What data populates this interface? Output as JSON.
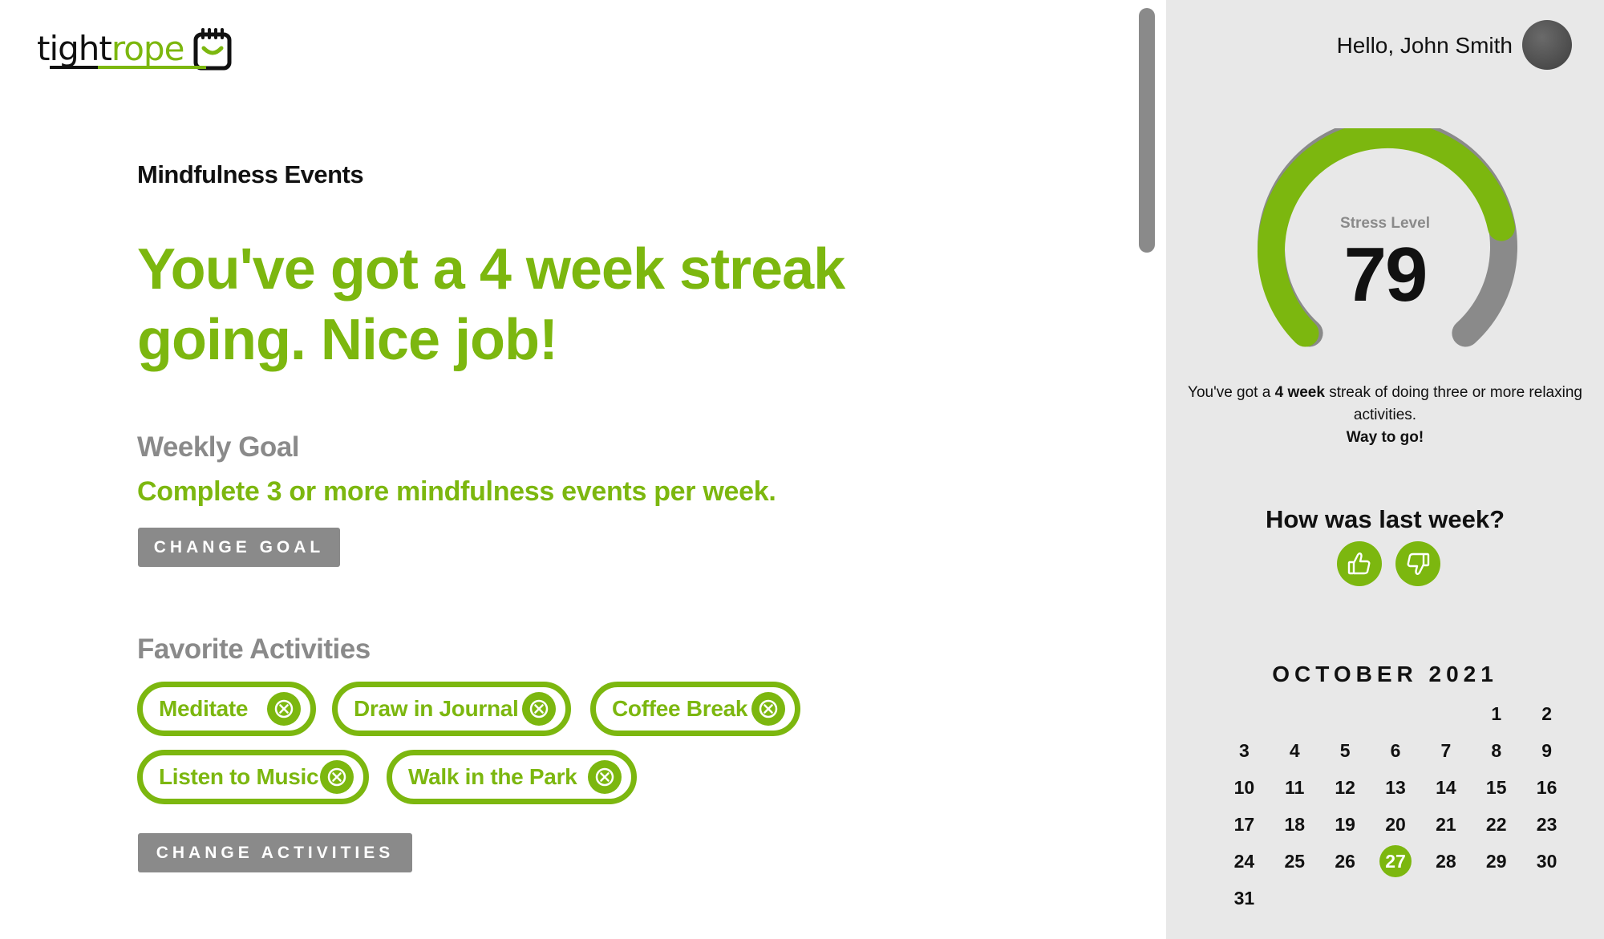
{
  "logo": {
    "part1": "tight",
    "part2": "rope"
  },
  "header": {
    "greeting": "Hello, John Smith"
  },
  "main": {
    "section_label": "Mindfulness Events",
    "headline": "You've got a 4 week streak going. Nice job!",
    "weekly_goal": {
      "heading": "Weekly Goal",
      "text": "Complete 3 or more mindfulness events per week.",
      "button_label": "CHANGE GOAL"
    },
    "favorites": {
      "heading": "Favorite Activities",
      "activities": [
        "Meditate",
        "Draw in Journal",
        "Coffee Break",
        "Listen to Music",
        "Walk in the Park"
      ],
      "button_label": "CHANGE ACTIVITIES"
    }
  },
  "panel": {
    "gauge": {
      "label": "Stress Level",
      "value": "79",
      "max": 100
    },
    "streak_message": {
      "pre": "You've got a ",
      "bold": "4 week",
      "post": " streak of doing three or more relaxing activities.",
      "closing": "Way to go!"
    },
    "feedback": {
      "question": "How was last week?"
    },
    "calendar": {
      "title": "OCTOBER 2021",
      "today": 27,
      "weeks": [
        [
          "",
          "",
          "",
          "",
          "",
          "1",
          "2"
        ],
        [
          "3",
          "4",
          "5",
          "6",
          "7",
          "8",
          "9"
        ],
        [
          "10",
          "11",
          "12",
          "13",
          "14",
          "15",
          "16"
        ],
        [
          "17",
          "18",
          "19",
          "20",
          "21",
          "22",
          "23"
        ],
        [
          "24",
          "25",
          "26",
          "27",
          "28",
          "29",
          "30"
        ],
        [
          "31",
          "",
          "",
          "",
          "",
          "",
          ""
        ]
      ]
    }
  },
  "colors": {
    "accent": "#7cb70f",
    "muted": "#8a8a8a",
    "panel_bg": "#e8e8e8"
  }
}
